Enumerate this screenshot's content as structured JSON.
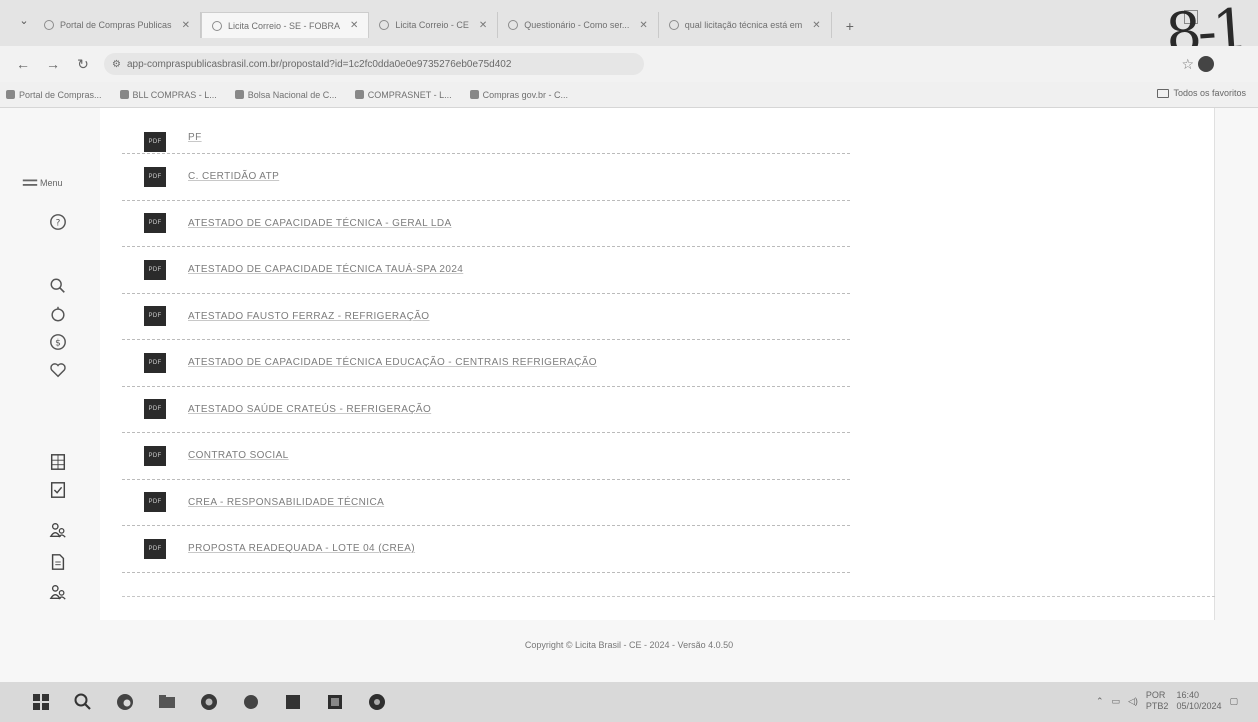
{
  "browser": {
    "tabs": [
      {
        "label": "Portal de Compras Publicas"
      },
      {
        "label": "Licita Correio - SE - FOBRA"
      },
      {
        "label": "Licita Correio - CE"
      },
      {
        "label": "Questionário - Como ser..."
      },
      {
        "label": "qual licitação técnica está em"
      }
    ],
    "active_tab": 1,
    "url": "app-compraspublicasbrasil.com.br/propostaId?id=1c2fc0dda0e0e9735276eb0e75d402",
    "page_number_handwritten": "8-1"
  },
  "bookmarks": {
    "items": [
      "Portal de Compras...",
      "BLL COMPRAS - L...",
      "Bolsa Nacional de C...",
      "COMPRASNET - L...",
      "Compras gov.br - C..."
    ],
    "all_label": "Todos os favoritos"
  },
  "sidebar": {
    "menu_label": "Menu",
    "icons": [
      "menu-icon",
      "help-icon",
      "search-icon",
      "timer-icon",
      "dollar-icon",
      "heart-icon",
      "grid-icon",
      "checklist-icon",
      "users-icon",
      "document-icon",
      "users-group-icon"
    ]
  },
  "documents": [
    {
      "name": "PF"
    },
    {
      "name": "C. CERTIDÃO ATP"
    },
    {
      "name": "ATESTADO DE CAPACIDADE TÉCNICA - GERAL LDA"
    },
    {
      "name": "ATESTADO DE CAPACIDADE TÉCNICA TAUÁ-SPA 2024"
    },
    {
      "name": "ATESTADO FAUSTO FERRAZ - REFRIGERAÇÃO"
    },
    {
      "name": "ATESTADO DE CAPACIDADE TÉCNICA EDUCAÇÃO - CENTRAIS REFRIGERAÇÃO"
    },
    {
      "name": "ATESTADO SAÚDE CRATEÚS - REFRIGERAÇÃO"
    },
    {
      "name": "CONTRATO SOCIAL"
    },
    {
      "name": "CREA - RESPONSABILIDADE TÉCNICA"
    },
    {
      "name": "PROPOSTA READEQUADA - LOTE 04 (CREA)"
    }
  ],
  "pdf_label": "PDF",
  "footer": {
    "text": "Copyright © Licita Brasil - CE - 2024 - Versão 4.0.50"
  },
  "taskbar": {
    "language": "POR",
    "layout": "PTB2",
    "time": "16:40",
    "date": "05/10/2024"
  }
}
